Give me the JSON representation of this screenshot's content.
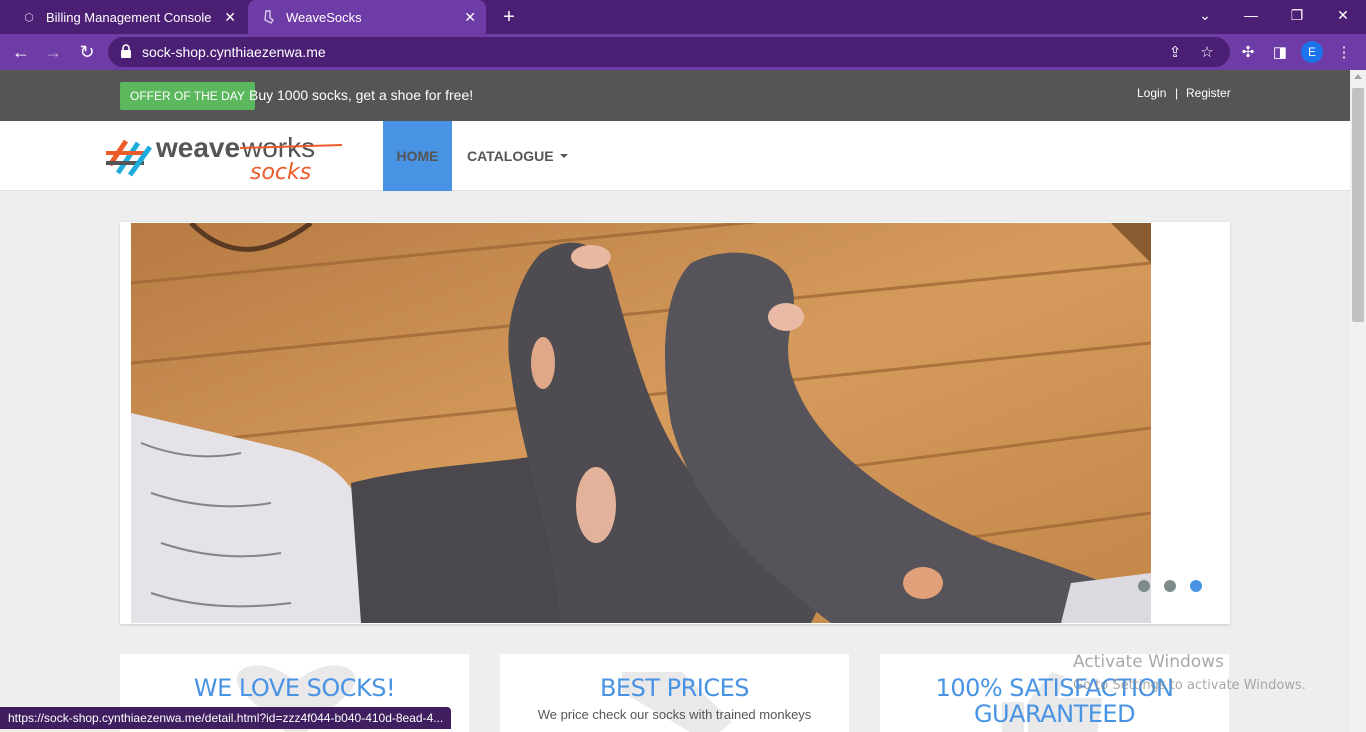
{
  "browser": {
    "tabs": [
      {
        "title": "Billing Management Console",
        "icon": "cube-icon"
      },
      {
        "title": "WeaveSocks",
        "icon": "sock-icon"
      }
    ],
    "new_tab_label": "+",
    "url": "sock-shop.cynthiaezenwa.me",
    "profile_initial": "E",
    "status_url": "https://sock-shop.cynthiaezenwa.me/detail.html?id=zzz4f044-b040-410d-8ead-4..."
  },
  "topbar": {
    "offer_label": "OFFER OF THE DAY",
    "offer_text": "Buy 1000 socks, get a shoe for free!",
    "login": "Login",
    "separator": "|",
    "register": "Register"
  },
  "logo": {
    "word1": "weave",
    "word2": "works",
    "word3": "socks"
  },
  "nav": {
    "home": "HOME",
    "catalogue": "CATALOGUE"
  },
  "slider": {
    "active_index": 2,
    "count": 3
  },
  "features": [
    {
      "title": "WE LOVE SOCKS!"
    },
    {
      "title": "BEST PRICES",
      "text": "We price check our socks with trained monkeys"
    },
    {
      "title": "100% SATISFACTION GUARANTEED"
    }
  ],
  "watermark": {
    "line1": "Activate Windows",
    "line2": "Go to Settings to activate Windows."
  },
  "colors": {
    "accent": "#4993e4",
    "offer": "#5cb85c",
    "chrome": "#4b1f74"
  }
}
